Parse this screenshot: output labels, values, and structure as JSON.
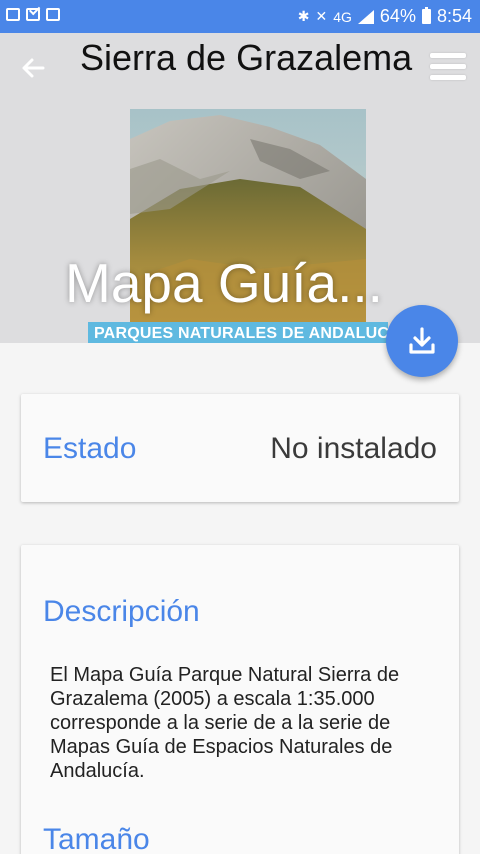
{
  "status_bar": {
    "network": "4G",
    "battery": "64%",
    "time": "8:54"
  },
  "header": {
    "title": "Sierra de Grazalema",
    "overlay_title": "Mapa Guía...",
    "cover_banner": "PARQUES NATURALES DE ANDALUCÍA"
  },
  "estado": {
    "label": "Estado",
    "value": "No instalado"
  },
  "info": {
    "description_heading": "Descripción",
    "description_text": "El Mapa Guía Parque Natural Sierra de Grazalema (2005) a escala 1:35.000 corresponde a la serie de a la serie de Mapas Guía de Espacios Naturales de Andalucía.",
    "size_heading": "Tamaño"
  },
  "colors": {
    "accent": "#4a86e8",
    "header_bg": "#dddddf",
    "banner": "#5fb9e0"
  },
  "icons": {
    "back": "arrow-left-icon",
    "menu": "hamburger-menu-icon",
    "download": "download-icon"
  }
}
